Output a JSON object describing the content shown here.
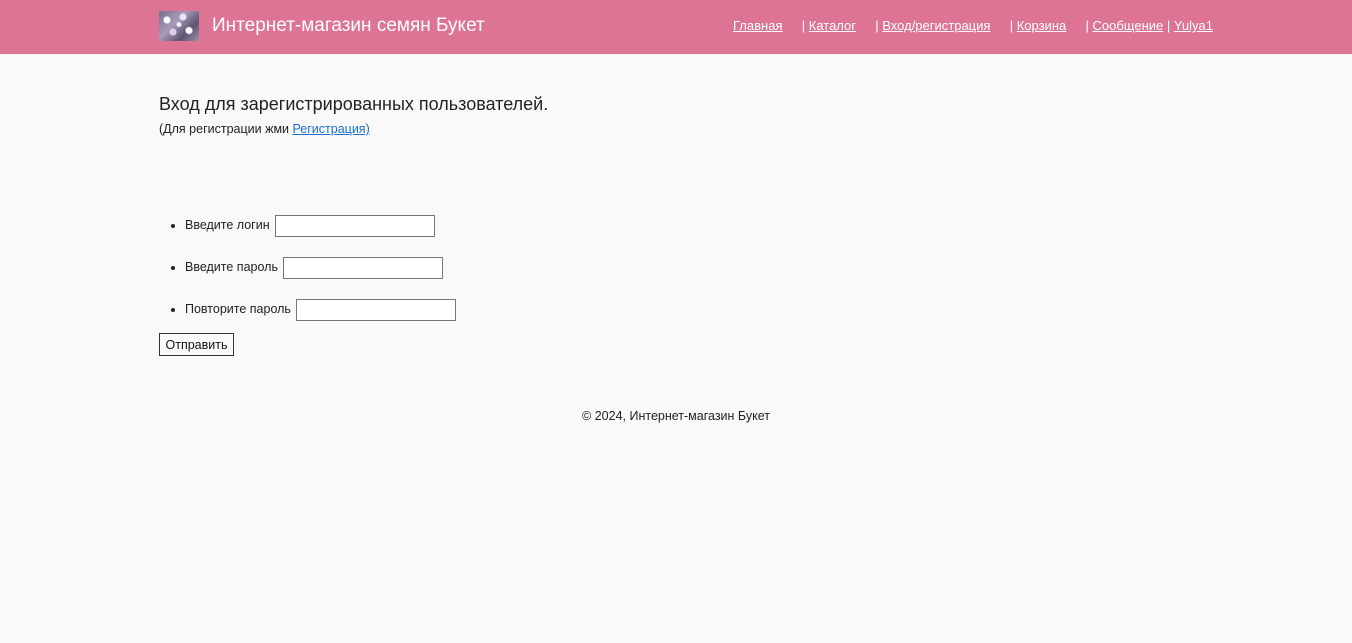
{
  "header": {
    "logo_icon": "flower-bouquet-logo",
    "title": "Интернет-магазин семян Букет",
    "background": "#de7493",
    "nav": [
      {
        "label": "Главная",
        "sep_before": ""
      },
      {
        "label": "Каталог",
        "sep_before": "|"
      },
      {
        "label": "Вход/регистрация",
        "sep_before": "|"
      },
      {
        "label": "Корзина",
        "sep_before": "|"
      },
      {
        "label": "Сообщение",
        "sep_before": "|"
      },
      {
        "label": "Yulya1",
        "sep_before": "|"
      }
    ]
  },
  "main": {
    "heading": "Вход для зарегистрированных пользователей.",
    "hint_prefix": "(Для регистрации жми ",
    "hint_link": "Регистрация)",
    "fields": [
      {
        "label": "Введите логин",
        "value": ""
      },
      {
        "label": "Введите пароль",
        "value": ""
      },
      {
        "label": "Повторите пароль",
        "value": ""
      }
    ],
    "submit_label": "Отправить"
  },
  "footer": {
    "text": "© 2024, Интернет-магазин Букет"
  }
}
